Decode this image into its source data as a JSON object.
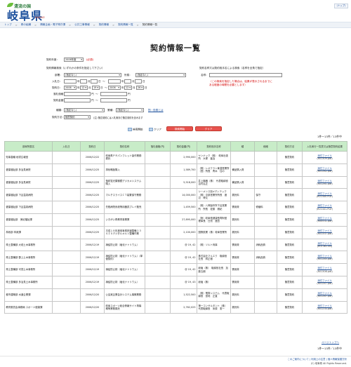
{
  "header": {
    "logo_small": "清流の国",
    "logo_big": "岐阜県",
    "logo_tag": "NAMAKE",
    "info_link": "(トップ)"
  },
  "breadcrumb": [
    "トップ",
    "県の組織",
    "情報企画・電子県庁課",
    "公共工事情報",
    "契約情報",
    "契約情報一覧",
    "契約情報一覧"
  ],
  "page_title": "契約情報一覧",
  "form": {
    "fiscal_year_label": "契約年度：",
    "fiscal_year_value": "2006年度",
    "required_mark": "(必須)",
    "category_label": "契約情報検索（いずれかの条件を指定して下さい）",
    "dept_label": "部署：",
    "dept_value": "(指定なし)",
    "office_label": "所属：",
    "office_value": "(指定なし)",
    "bid_date_label": "入札日：",
    "bid_date_sep": "〜",
    "contract_date_label": "契約日：",
    "contract_from": {
      "y": "2006",
      "m": "12",
      "d": "19"
    },
    "contract_to": {
      "y": "2006",
      "m": "12",
      "d": "26"
    },
    "year_unit": "年",
    "month_unit": "月",
    "day_unit": "日",
    "amount_label": "落札価格：",
    "amount_unit": "円",
    "contract_amount_label": "契約金額：",
    "type_label": "種類：",
    "type_value": "(指定なし)",
    "industry_label": "業種：",
    "industry_value": "(指定なし)",
    "industry_link": "物・役務とは",
    "method_label": "契約方法：",
    "method_value": "随意契約",
    "method_note": "(注) 随意契約には入札無効で随意契約を含みます",
    "name_search_label": "契約名称又は契約相手名による検索（名称を全角で指定）",
    "name_label": "名称：",
    "name_note1": "（この検索を指定した場合は、結果が表示されるまでに",
    "name_note2": "ある程度の時間を必要とします）",
    "start_label": "検索開始",
    "clear_label": "クリア",
    "search_button": "検索開始",
    "clear_button": "クリア"
  },
  "result_count": "1件～13件／13件中",
  "table": {
    "headers": [
      "部局所属名",
      "入札日",
      "契約日",
      "契約名称",
      "落札価格(円)",
      "契約金額(円)",
      "契約相手名称",
      "種",
      "細細",
      "契約方法",
      "入札執行一覧表又は随意契約結果"
    ],
    "rows": [
      [
        "知事直轄 秘書広報室",
        "",
        "2006/12/22",
        "岐阜県ＰＲパンフレット製作業務委託",
        "",
        "2,990,000",
        "ヤンナック（株）　岐阜出張所　大塚　猛治",
        "",
        "",
        "随意契約",
        "添付ファイル",
        "(R01309.pdf)"
      ],
      [
        "健康福祉部 多治見病院",
        "",
        "2006/12/25",
        "排砂略板購入",
        "",
        "1,589,700",
        "（株）レオクラン東濃営業所　（営）所長　青木　住の",
        "備品購入費",
        "",
        "随意契約",
        "添付ファイル",
        "(R01262.pdf)"
      ],
      [
        "健康福祉部 多治見病院",
        "",
        "2006/12/25",
        "落射蛍光顕微鏡デジカメシステム購入",
        "",
        "5,518,000",
        "井上機器（株）　代表取締役　吉村弘正",
        "備品購入費",
        "",
        "随意契約",
        "添付ファイル",
        "(R01261.pdf)"
      ],
      [
        "健康福祉部 下呂温泉病院",
        "",
        "2006/12/25",
        "マルチスライスＣＴ装置保守業務",
        "",
        "14,000,000",
        "シーメンス旭メディテック（株）中部営業所所長　渡辺　博文",
        "委託料",
        "保守",
        "随意契約",
        "添付ファイル",
        "(R01440.PDF)"
      ],
      [
        "健康福祉部 下呂温泉病院",
        "",
        "2006/12/25",
        "先程病院系統等用器具プレイ販売",
        "",
        "1,459,500",
        "（株）八神製作所下呂営業所　所長　佐藤　雅紀",
        "需用費",
        "修繕料",
        "随意契約",
        "添付ファイル",
        "(R01441.PDF)"
      ],
      [
        "健康福祉部　美紀福祉課",
        "",
        "2006/12/25",
        "いきがい再教育事業業",
        "",
        "27,895,000",
        "（財）岐阜県健康長寿財団　理事長　日賀　進吾",
        "委託料",
        "",
        "随意契約",
        "添付ファイル",
        "(R00531.pdf)"
      ],
      [
        "林政部 林政課",
        "",
        "2006/12/25",
        "平成１８年度岐阜県林道整備２３ＧＩＳデジタルオルソ整備作業",
        "",
        "2,100,000",
        "国際航業（株）岐阜営業所",
        "委託料",
        "",
        "随意契約",
        "添付ファイル",
        "(R01337.pdf)"
      ],
      [
        "県土整備部 大垣土木事務所",
        "",
        "2006/12/19",
        "凍結防止剤（塩化ナトリウム）",
        "",
        "@ 19, 42",
        "（株）ソルト商事",
        "需用費",
        "消耗品費",
        "随意契約",
        "添付ファイル",
        "(R01361.xls)"
      ],
      [
        "県土整備部 郡上土木事務所",
        "",
        "2006/12/19",
        "凍結防止剤（塩化ナトリウム）（単価契約）",
        "",
        "@ 19, 42",
        "株式会社マルエク　取締役社長　林正樹",
        "需用費",
        "消耗品費",
        "随意契約",
        "添付ファイル",
        "(R01285.pdf)"
      ],
      [
        "県土整備部 可茂土木事務所",
        "",
        "2006/12/19",
        "凍結防止剤（塩化ナトリウム）",
        "",
        "@ 19, 42",
        "総塩（株）　取締役社長　加藤五朗",
        "需用費",
        "",
        "随意契約",
        "添付ファイル",
        "(R01306.pdf)"
      ],
      [
        "県土整備部 多治見土木事務所",
        "",
        "2006/12/19",
        "凍結防止剤（塩化ナトリウム）",
        "",
        "@ 19, 43",
        "総塩（株）",
        "需用費",
        "",
        "随意契約",
        "添付ファイル",
        "(R01247.pdf)"
      ],
      [
        "都市建築部 水道企業課",
        "",
        "2006/12/20",
        "公会実企業会計システム構築業務",
        "",
        "1,522,500",
        "（株）電算システム　代表取締役　宮地　正直",
        "委託料",
        "",
        "随意契約",
        "添付ファイル",
        "(R01267.pdf)"
      ],
      [
        "教育委員会事務局 スポーツ健康課",
        "",
        "2006/12/20",
        "岐阜スポーツ総合情報サイト再構築等業務委託",
        "",
        "2,762,025",
        "第一コンサルタント（株）代表取締役　米原　憲一",
        "委託料",
        "",
        "随意契約",
        "添付ファイル",
        "(R01230.pdf)"
      ]
    ]
  },
  "page_top": "ページトップへ",
  "result_count_bottom": "1件～13件／13件中",
  "footer": {
    "links": "このご案内について | 利用上の注意 | 個人情報保護方針",
    "copyright": "(C) 岐阜県 All Rights Reserved."
  },
  "colors": {
    "table_header_bg": "#c8ecc8",
    "link": "#1b4f9c",
    "search_button": "#e8534f",
    "required": "#d40000"
  }
}
